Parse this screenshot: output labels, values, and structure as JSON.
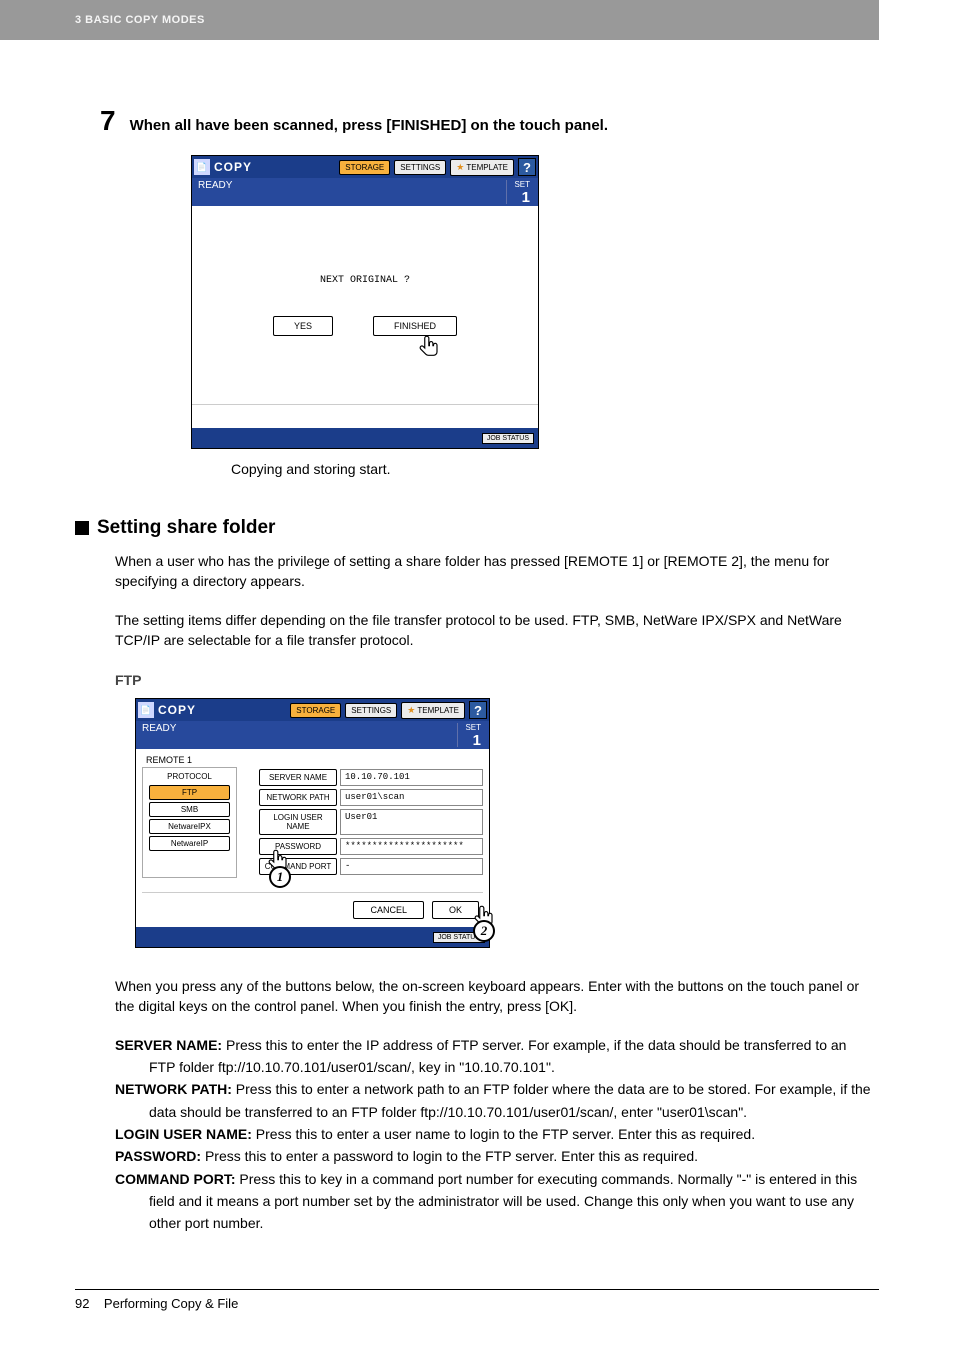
{
  "header": {
    "breadcrumb": "3 BASIC COPY MODES"
  },
  "step": {
    "num": "7",
    "text": "When all have been scanned, press [FINISHED] on the touch panel."
  },
  "ss_common": {
    "title": "COPY",
    "tab_storage": "STORAGE",
    "tab_settings": "SETTINGS",
    "tab_template": "TEMPLATE",
    "help": "?",
    "ready": "READY",
    "set_lbl": "SET",
    "set_num": "1",
    "jobstatus": "JOB STATUS"
  },
  "ss1": {
    "prompt": "NEXT ORIGINAL ?",
    "yes": "YES",
    "finished": "FINISHED"
  },
  "caption1": "Copying and storing start.",
  "section": {
    "title": "Setting share folder",
    "p1": "When a user who has the privilege of setting a share folder has pressed [REMOTE 1] or [REMOTE 2], the menu for specifying a directory appears.",
    "p2": "The setting items differ depending on the file transfer protocol to be used. FTP, SMB, NetWare IPX/SPX and NetWare TCP/IP are selectable for a file transfer protocol."
  },
  "ftp": {
    "heading": "FTP",
    "remote": "REMOTE 1",
    "protocol_lbl": "PROTOCOL",
    "opts": {
      "ftp": "FTP",
      "smb": "SMB",
      "nwipx": "NetwareIPX",
      "nwip": "NetwareIP"
    },
    "fields": {
      "server_lbl": "SERVER NAME",
      "server_val": "10.10.70.101",
      "path_lbl": "NETWORK PATH",
      "path_val": "user01\\scan",
      "login_lbl": "LOGIN USER NAME",
      "login_val": "User01",
      "pw_lbl": "PASSWORD",
      "pw_val": "**********************",
      "port_lbl": "COMMAND PORT",
      "port_val": "-"
    },
    "cancel": "CANCEL",
    "ok": "OK"
  },
  "desc": "When you press any of the buttons below, the on-screen keyboard appears. Enter with the buttons on the touch panel or the digital keys on the control panel. When you finish the entry, press [OK].",
  "defs": {
    "server_b": "SERVER NAME:",
    "server_t1": " Press this to enter the IP address of FTP server. For example, if the data should be transferred to an",
    "server_t2": "FTP folder ftp://10.10.70.101/user01/scan/, key in \"10.10.70.101\".",
    "path_b": "NETWORK PATH:",
    "path_t1": " Press this to enter a network path to an FTP folder where the data are to be stored. For example, if the",
    "path_t2": "data should be transferred to an FTP folder ftp://10.10.70.101/user01/scan/, enter \"user01\\scan\".",
    "login_b": "LOGIN USER NAME:",
    "login_t": " Press this to enter a user name to login to the FTP server. Enter this as required.",
    "pw_b": "PASSWORD:",
    "pw_t": " Press this to enter a password to login to the FTP server. Enter this as required.",
    "port_b": "COMMAND PORT:",
    "port_t1": " Press this to key in a command port number for executing commands. Normally \"-\" is entered in this",
    "port_t2": "field and it means a port number set by the administrator will be used. Change this only when you want to use any",
    "port_t3": "other port number."
  },
  "footer": {
    "pagenum": "92",
    "label": "Performing Copy & File"
  }
}
